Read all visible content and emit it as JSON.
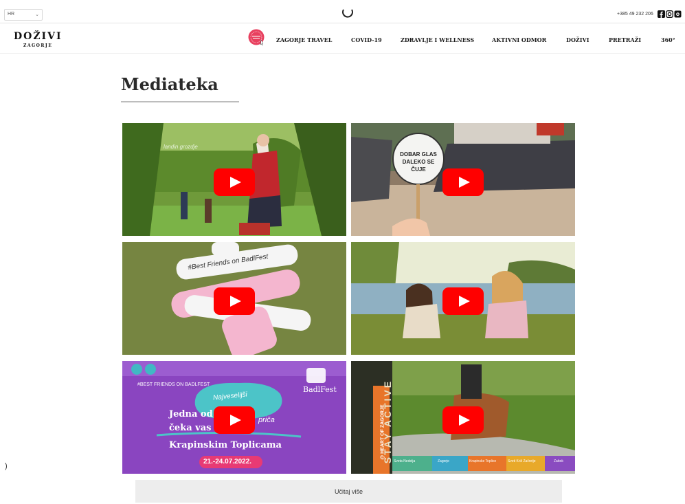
{
  "topbar": {
    "language": "HR",
    "phone": "+385 49 232 206",
    "social": [
      {
        "icon": "facebook-icon"
      },
      {
        "icon": "instagram-icon"
      },
      {
        "icon": "camera-icon"
      }
    ]
  },
  "header": {
    "logo_text": "DOŽIVI",
    "logo_sub": "ZAGORJE",
    "nav": [
      {
        "label": "ZAGORJE TRAVEL"
      },
      {
        "label": "COVID-19"
      },
      {
        "label": "ZDRAVLJE I WELLNESS"
      },
      {
        "label": "AKTIVNI ODMOR"
      },
      {
        "label": "DOŽIVI"
      },
      {
        "label": "PRETRAŽI"
      },
      {
        "label": "360°"
      }
    ]
  },
  "main": {
    "title": "Mediateka",
    "load_more": "Učitaj više"
  },
  "videos": [
    {
      "scene": "grape-harvest",
      "overlay": "landin grozdje"
    },
    {
      "scene": "festival-crowd",
      "overlay": "DOBAR GLAS DALEKO SE ČUJE"
    },
    {
      "scene": "pink-wristbands",
      "overlay": "#Best Friends on BadlFest"
    },
    {
      "scene": "lake-sunset",
      "overlay": ""
    },
    {
      "scene": "badlfest-poster",
      "overlay_lines": [
        "Najveselijši",
        "Jedna od",
        "priča",
        "čeka vas u",
        "Krapinskim Toplicama",
        "21.-24.07.2022.",
        "BadlFest",
        "#BEST FRIENDS ON BADLFEST"
      ]
    },
    {
      "scene": "horse-ride",
      "overlay_lines": [
        "STAY ACTIVE",
        "@ HEART OF ZAGORJE",
        "Sveta Nedelja",
        "Zagorje",
        "Krapinske Toplice",
        "Sveti Križ Začretje",
        "Zabok"
      ]
    }
  ],
  "colors": {
    "youtube_red": "#ff0000",
    "poster_purple": "#8a45c0",
    "accent_pink": "#e83a74"
  }
}
